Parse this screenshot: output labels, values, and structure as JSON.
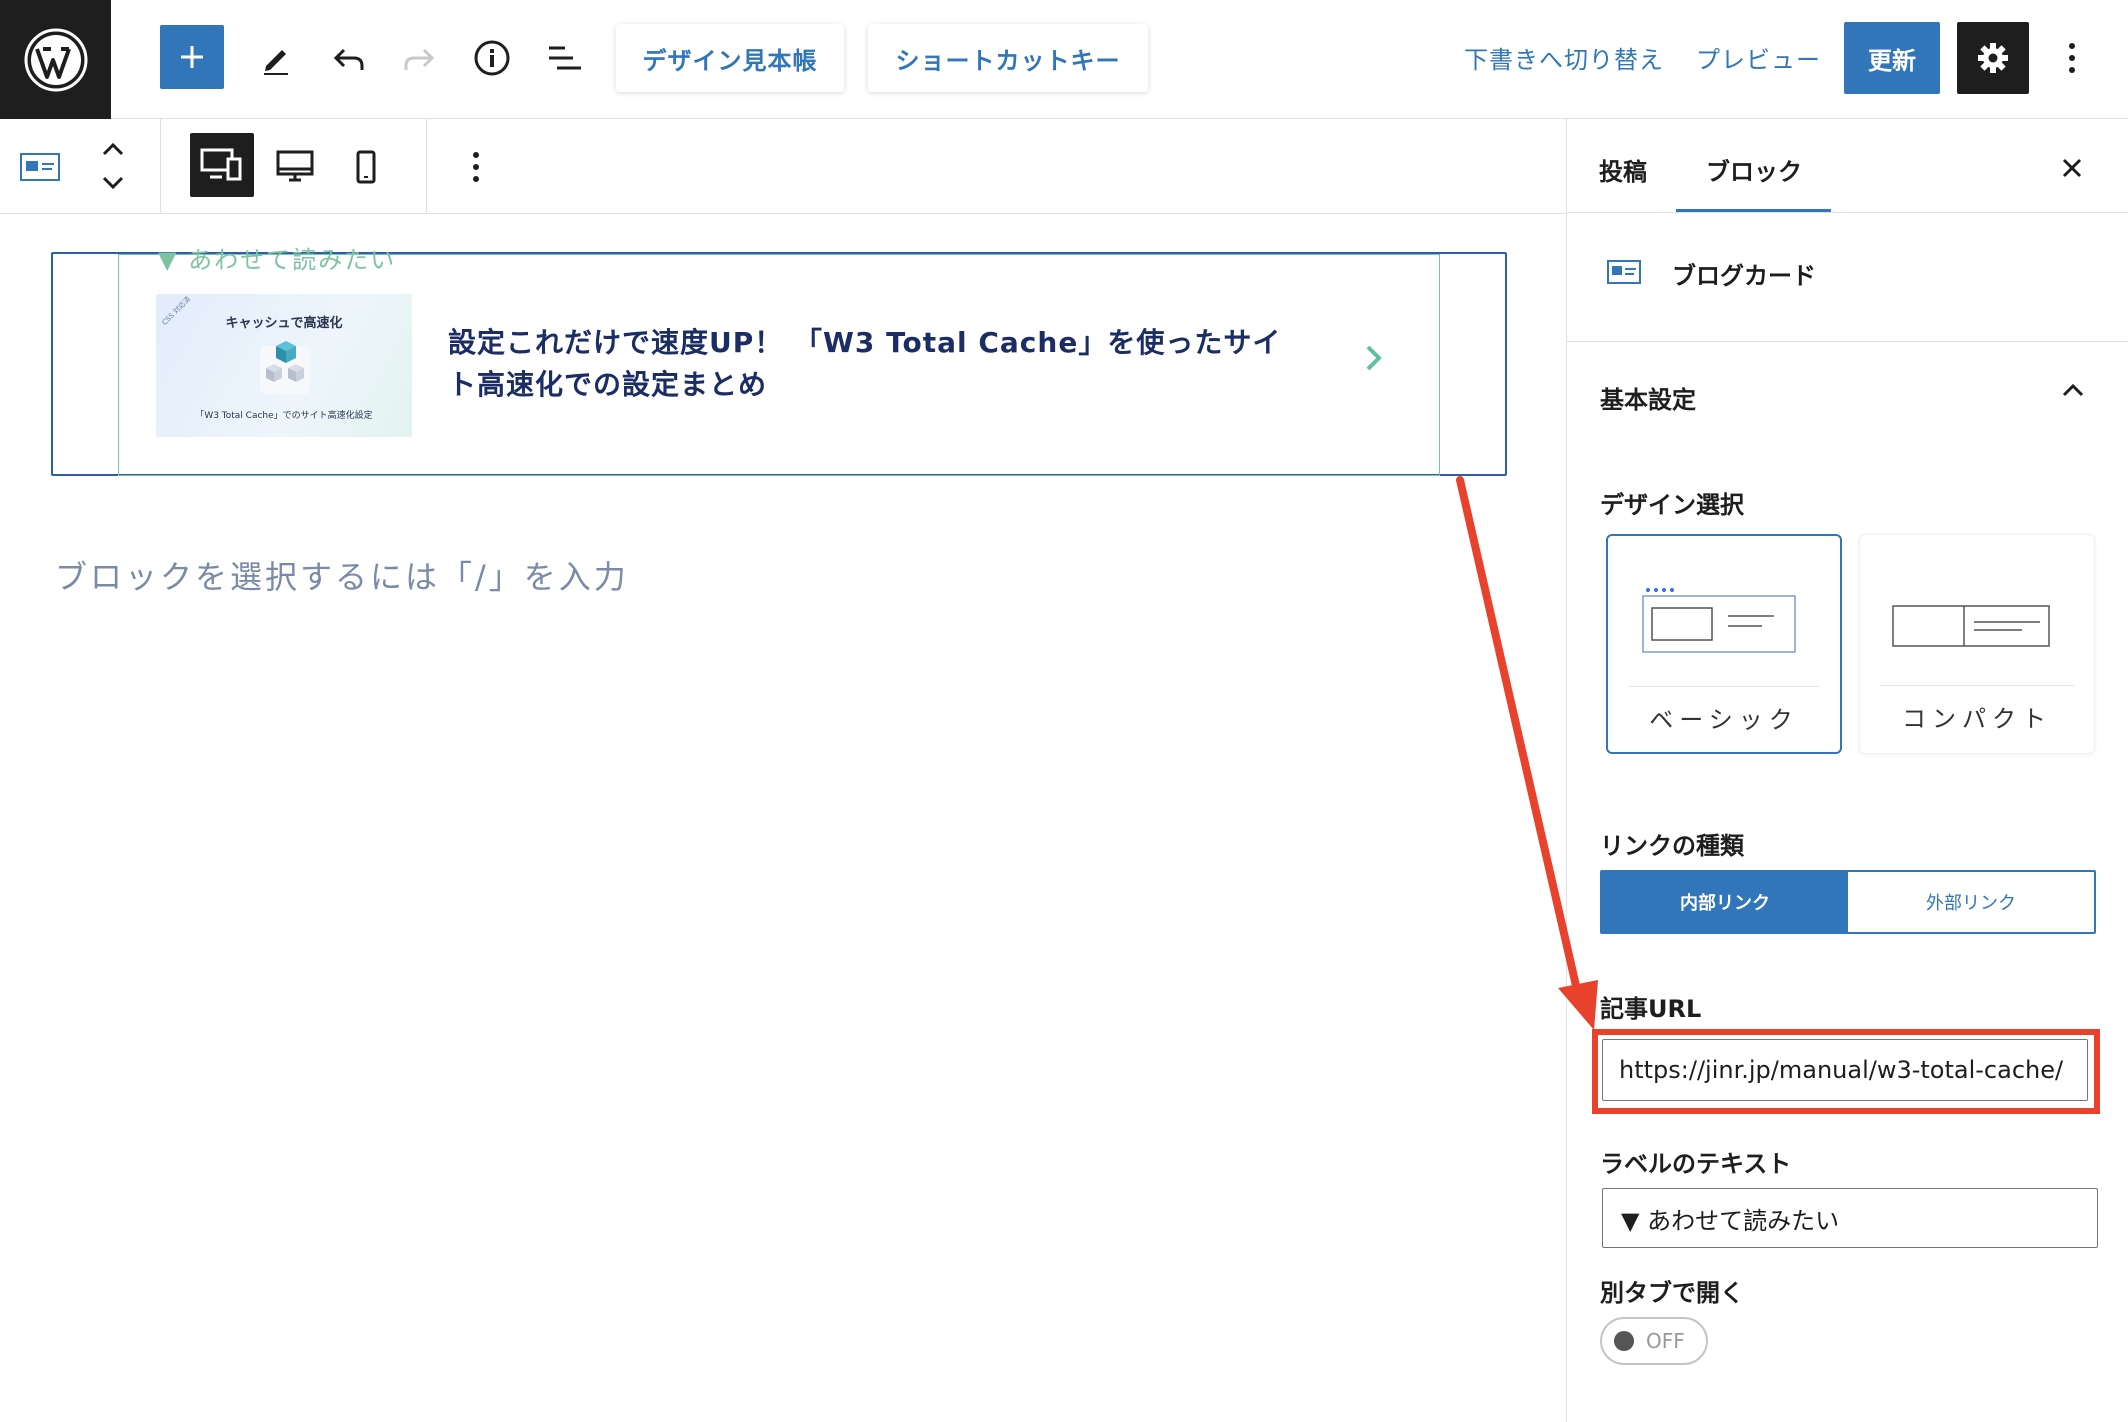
{
  "toolbar": {
    "pattern_library_label": "デザイン見本帳",
    "shortcut_keys_label": "ショートカットキー",
    "switch_to_draft_label": "下書きへ切り替え",
    "preview_label": "プレビュー",
    "update_label": "更新"
  },
  "editor": {
    "blogcard": {
      "label": "▼ あわせて読みたい",
      "thumbnail_title": "キャッシュで高速化",
      "thumbnail_caption": "「W3 Total Cache」でのサイト高速化設定",
      "thumbnail_tag": "CSS 対応済",
      "title": "設定これだけで速度UP！ 「W3 Total Cache」を使ったサイト高速化での設定まとめ"
    },
    "placeholder": "ブロックを選択するには「/」を入力"
  },
  "sidebar": {
    "tabs": [
      {
        "label": "投稿"
      },
      {
        "label": "ブロック"
      }
    ],
    "block_name": "ブログカード",
    "panel_title": "基本設定",
    "design_select_label": "デザイン選択",
    "design_options": [
      {
        "label": "ベーシック",
        "selected": true
      },
      {
        "label": "コンパクト",
        "selected": false
      }
    ],
    "link_type_label": "リンクの種類",
    "link_types": [
      {
        "label": "内部リンク",
        "selected": true
      },
      {
        "label": "外部リンク",
        "selected": false
      }
    ],
    "url_label": "記事URL",
    "url_value": "https://jinr.jp/manual/w3-total-cache/",
    "label_text_label": "ラベルのテキスト",
    "label_text_value": "▼ あわせて読みたい",
    "new_tab_label": "別タブで開く",
    "new_tab_state": "OFF"
  },
  "colors": {
    "accent": "#3176b9",
    "annotation": "#e8412c",
    "card_border": "#7ec4a3",
    "card_title": "#1b2d64"
  }
}
